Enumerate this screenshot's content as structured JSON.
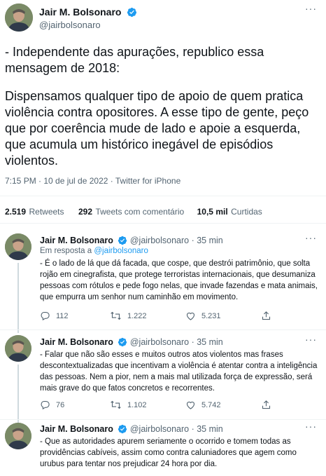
{
  "main_tweet": {
    "author": "Jair M. Bolsonaro",
    "handle": "@jairbolsonaro",
    "paragraph1": "- Independente das apurações, republico essa mensagem de 2018:",
    "paragraph2": "Dispensamos qualquer tipo de apoio de quem pratica violência contra opositores. A esse tipo de gente, peço que por coerência mude de lado e apoie a esquerda, que acumula um histórico inegável de episódios violentos.",
    "timestamp": "7:15 PM · 10 de jul de 2022 · Twitter for iPhone"
  },
  "stats": {
    "retweets_count": "2.519",
    "retweets_label": "Retweets",
    "quotes_count": "292",
    "quotes_label": "Tweets com comentário",
    "likes_count": "10,5 mil",
    "likes_label": "Curtidas"
  },
  "replies": [
    {
      "author": "Jair M. Bolsonaro",
      "handle_time": "@jairbolsonaro · 35 min",
      "reply_to_prefix": "Em resposta a",
      "reply_to_handle": "@jairbolsonaro",
      "text": "- É o lado de lá que dá facada, que cospe, que destrói patrimônio, que solta rojão em cinegrafista, que protege terroristas internacionais, que desumaniza pessoas com rótulos e pede fogo nelas, que invade fazendas e mata animais, que empurra um senhor num caminhão em movimento.",
      "replies_count": "112",
      "retweets_count": "1.222",
      "likes_count": "5.231"
    },
    {
      "author": "Jair M. Bolsonaro",
      "handle_time": "@jairbolsonaro · 35 min",
      "text": "- Falar que não são esses e muitos outros atos violentos mas frases descontextualizadas que incentivam a violência é atentar contra a inteligência das pessoas. Nem a pior, nem a mais mal utilizada força de expressão, será mais grave do que fatos concretos e recorrentes.",
      "replies_count": "76",
      "retweets_count": "1.102",
      "likes_count": "5.742"
    },
    {
      "author": "Jair M. Bolsonaro",
      "handle_time": "@jairbolsonaro · 35 min",
      "text": "- Que as autoridades apurem seriamente o ocorrido e tomem todas as providências cabíveis, assim como contra caluniadores que agem como urubus para tentar nos prejudicar 24 hora por dia."
    }
  ],
  "colors": {
    "accent": "#1d9bf0",
    "secondary_text": "#536471",
    "divider": "#eff3f4"
  },
  "icons": [
    "verified-badge-icon",
    "more-options-icon",
    "reply-icon",
    "retweet-icon",
    "like-icon",
    "share-icon"
  ]
}
